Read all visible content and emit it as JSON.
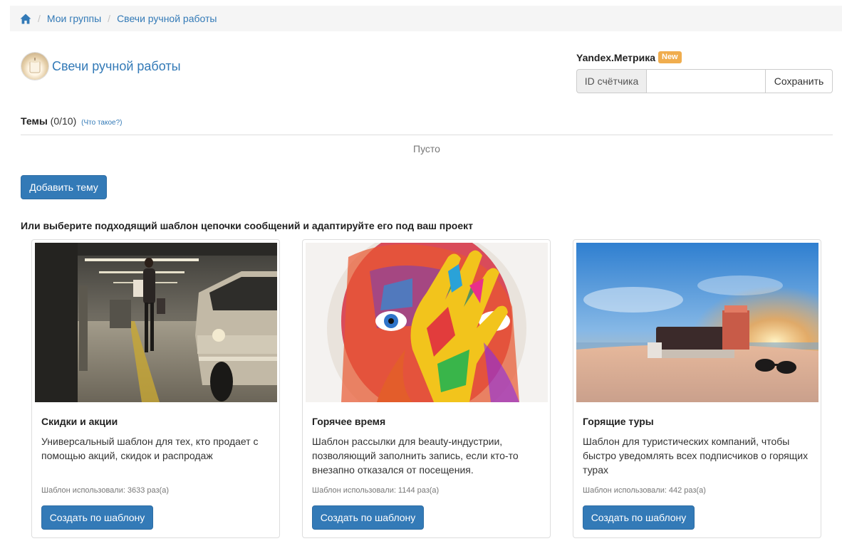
{
  "breadcrumb": {
    "home_icon": "home-icon",
    "items": [
      "Мои группы",
      "Свечи ручной работы"
    ],
    "separator": "/"
  },
  "group": {
    "title": "Свечи ручной работы"
  },
  "metrika": {
    "title": "Yandex.Метрика",
    "badge": "New",
    "addon_label": "ID счётчика",
    "input_value": "",
    "save_label": "Сохранить"
  },
  "topics": {
    "label": "Темы",
    "count": "(0/10)",
    "help_link": "(Что такое?)",
    "empty_text": "Пусто",
    "add_button": "Добавить тему"
  },
  "templates": {
    "heading": "Или выберите подходящий шаблон цепочки сообщений и адаптируйте его под ваш проект",
    "usage_prefix": "Шаблон использовали:",
    "usage_suffix": "раз(а)",
    "button_label": "Создать по шаблону",
    "cards": [
      {
        "title": "Скидки и акции",
        "description": "Универсальный шаблон для тех, кто продает с помощью акций, скидок и распродаж",
        "usage_count": "3633",
        "image": "parking-shopping-photo"
      },
      {
        "title": "Горячее время",
        "description": "Шаблон рассылки для beauty-индустрии, позволяющий заполнить запись, если кто-то внезапно отказался от посещения.",
        "usage_count": "1144",
        "image": "painted-face-photo"
      },
      {
        "title": "Горящие туры",
        "description": "Шаблон для туристических компаний, чтобы быстро уведомлять всех подписчиков о горящих турах",
        "usage_count": "442",
        "image": "beach-sunset-photo"
      }
    ]
  },
  "colors": {
    "link": "#337ab7",
    "primary_button": "#337ab7",
    "badge": "#f0ad4e",
    "breadcrumb_bg": "#f5f5f5"
  }
}
